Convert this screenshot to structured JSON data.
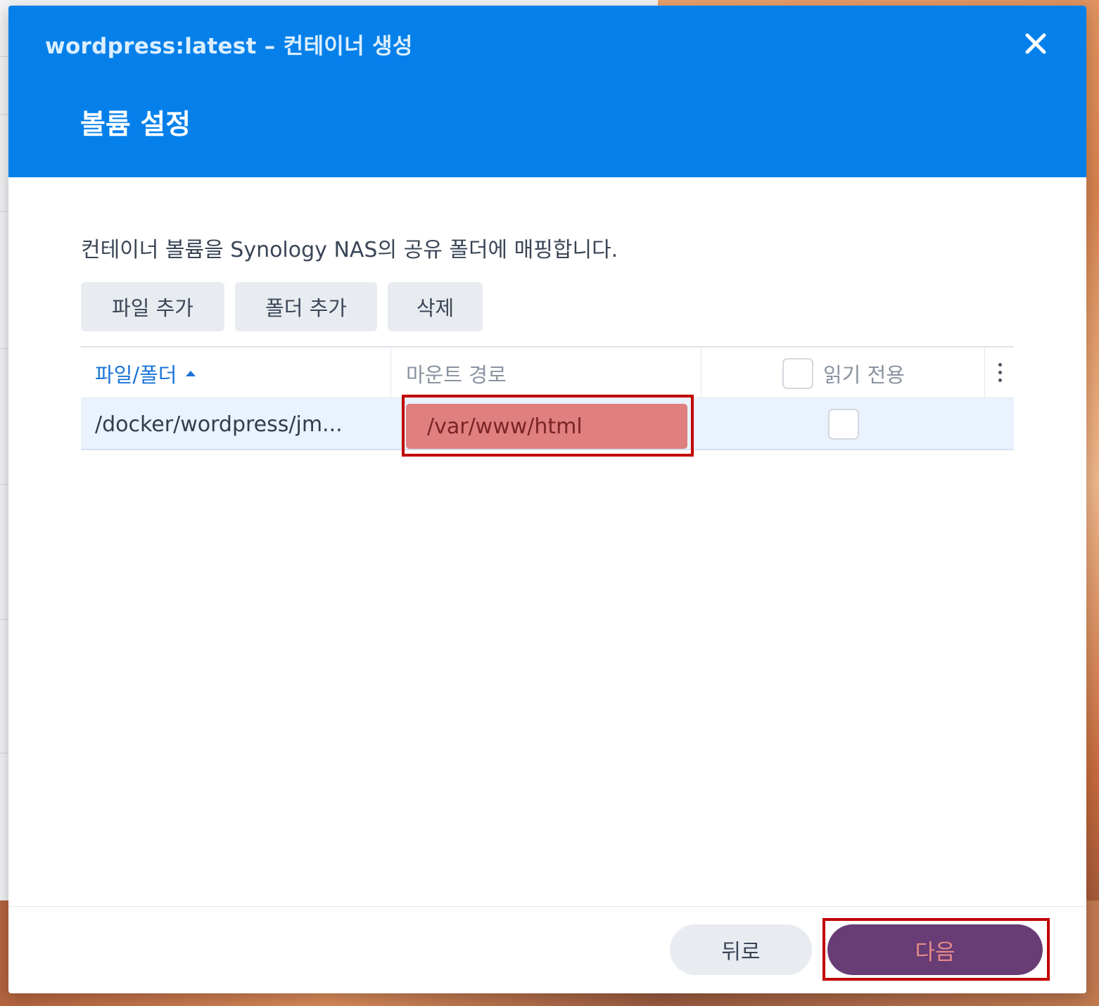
{
  "window": {
    "title": "wordpress:latest – 컨테이너 생성",
    "close_icon": "close-icon"
  },
  "step": {
    "title": "볼륨 설정"
  },
  "description": "컨테이너 볼륨을 Synology NAS의 공유 폴더에 매핑합니다.",
  "toolbar": {
    "add_file": "파일 추가",
    "add_folder": "폴더 추가",
    "delete": "삭제"
  },
  "table": {
    "columns": {
      "file_folder": "파일/폴더",
      "mount_path": "마운트 경로",
      "read_only": "읽기 전용"
    },
    "sort": {
      "column": "file_folder",
      "direction": "ascending"
    },
    "rows": [
      {
        "file_folder": "/docker/wordpress/jm...",
        "mount_path": "/var/www/html",
        "read_only": false
      }
    ]
  },
  "footer": {
    "back": "뒤로",
    "next": "다음"
  },
  "colors": {
    "header_blue": "#0580ea",
    "primary_button": "#683c74",
    "highlight": "#c30000"
  }
}
